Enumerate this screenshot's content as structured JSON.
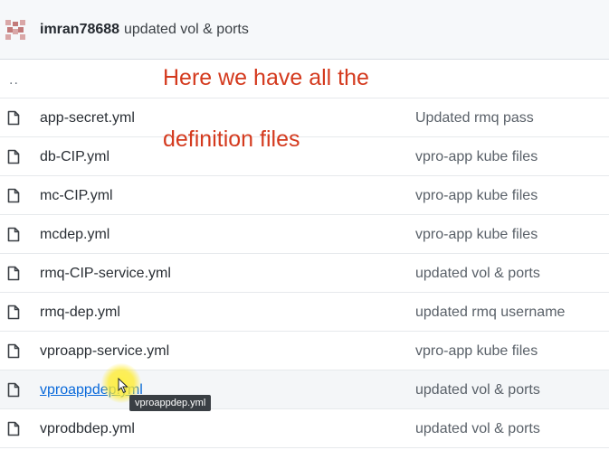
{
  "header": {
    "author": "imran78688",
    "message": "updated vol & ports",
    "avatar_icon": "identicon-avatar"
  },
  "annotation": {
    "line1": "Here we have all the",
    "line2": "definition files",
    "color": "#d43a1e"
  },
  "parent_dir": "..",
  "files": [
    {
      "name": "app-secret.yml",
      "commit": "Updated rmq pass"
    },
    {
      "name": "db-CIP.yml",
      "commit": "vpro-app kube files"
    },
    {
      "name": "mc-CIP.yml",
      "commit": "vpro-app kube files"
    },
    {
      "name": "mcdep.yml",
      "commit": "vpro-app kube files"
    },
    {
      "name": "rmq-CIP-service.yml",
      "commit": "updated vol & ports"
    },
    {
      "name": "rmq-dep.yml",
      "commit": "updated rmq username"
    },
    {
      "name": "vproapp-service.yml",
      "commit": "vpro-app kube files"
    },
    {
      "name": "vproappdep.yml",
      "commit": "updated vol & ports"
    },
    {
      "name": "vprodbdep.yml",
      "commit": "updated vol & ports"
    }
  ],
  "tooltip": "vproappdep.yml",
  "link_color": "#0969da"
}
